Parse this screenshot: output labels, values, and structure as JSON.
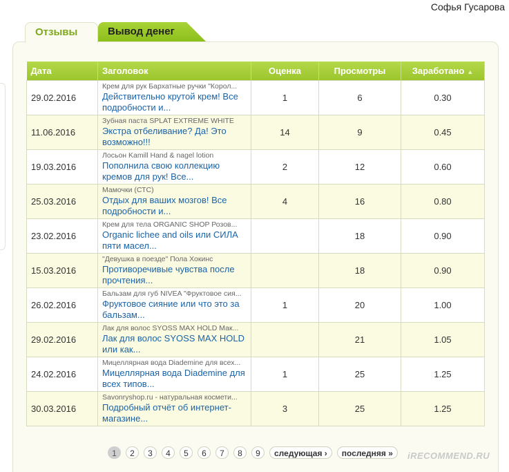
{
  "user": {
    "name": "Софья Гусарова"
  },
  "tabs": [
    {
      "label": "Отзывы"
    },
    {
      "label": "Вывод денег"
    }
  ],
  "table": {
    "headers": {
      "date": "Дата",
      "title": "Заголовок",
      "rating": "Оценка",
      "views": "Просмотры",
      "earned": "Заработано"
    },
    "sort_indicator": "▲",
    "rows": [
      {
        "date": "29.02.2016",
        "product": "Крем для рук Бархатные ручки \"Корол...",
        "title": "Действительно крутой крем! Все подробности и...",
        "rating": "1",
        "views": "6",
        "earned": "0.30"
      },
      {
        "date": "11.06.2016",
        "product": "Зубная паста SPLAT EXTREME WHITE",
        "title": "Экстра отбеливание? Да! Это возможно!!!",
        "rating": "14",
        "views": "9",
        "earned": "0.45"
      },
      {
        "date": "19.03.2016",
        "product": "Лосьон Kamill Hand & nagel lotion",
        "title": "Пополнила свою коллекцию кремов для рук! Все...",
        "rating": "2",
        "views": "12",
        "earned": "0.60"
      },
      {
        "date": "25.03.2016",
        "product": "Мамочки (СТС)",
        "title": "Отдых для ваших мозгов! Все подробности и...",
        "rating": "4",
        "views": "16",
        "earned": "0.80"
      },
      {
        "date": "23.02.2016",
        "product": "Крем для тела ORGANIC SHOP Розов...",
        "title": "Organic lichee and oils или СИЛА пяти масел...",
        "rating": "",
        "views": "18",
        "earned": "0.90"
      },
      {
        "date": "15.03.2016",
        "product": "\"Девушка в поезде\" Пола Хокинс",
        "title": "Противоречивые чувства после прочтения...",
        "rating": "",
        "views": "18",
        "earned": "0.90"
      },
      {
        "date": "26.02.2016",
        "product": "Бальзам для губ NIVEA \"Фруктовое сия...",
        "title": "Фруктовое сияние или что это за бальзам...",
        "rating": "1",
        "views": "20",
        "earned": "1.00"
      },
      {
        "date": "29.02.2016",
        "product": "Лак для волос SYOSS MAX HOLD Мак...",
        "title": "Лак для волос SYOSS MAX HOLD или как...",
        "rating": "",
        "views": "21",
        "earned": "1.05"
      },
      {
        "date": "24.02.2016",
        "product": "Мицеллярная вода Diademine для всех...",
        "title": "Мицеллярная вода Diademine для всех типов...",
        "rating": "1",
        "views": "25",
        "earned": "1.25"
      },
      {
        "date": "30.03.2016",
        "product": "Savonryshop.ru - натуральная космети...",
        "title": "Подробный отчёт об интернет-магазине...",
        "rating": "3",
        "views": "25",
        "earned": "1.25"
      }
    ]
  },
  "pagination": {
    "pages": [
      "1",
      "2",
      "3",
      "4",
      "5",
      "6",
      "7",
      "8",
      "9"
    ],
    "current": "1",
    "next_label": "следующая ›",
    "last_label": "последняя »"
  },
  "watermark": "iRECOMMEND.RU",
  "colors": {
    "header_green": "#9cc52c",
    "link_blue": "#1a63a8",
    "alt_row": "#fbfbe2"
  }
}
